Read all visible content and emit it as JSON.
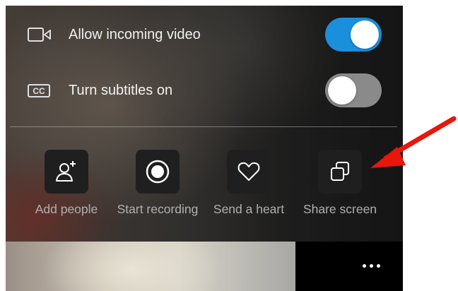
{
  "settings": [
    {
      "label": "Allow incoming video",
      "icon": "video-camera-icon",
      "enabled": true
    },
    {
      "label": "Turn subtitles on",
      "icon": "closed-captions-icon",
      "enabled": false
    }
  ],
  "actions": [
    {
      "label": "Add people",
      "icon": "add-person-icon"
    },
    {
      "label": "Start recording",
      "icon": "record-icon"
    },
    {
      "label": "Send a heart",
      "icon": "heart-icon"
    },
    {
      "label": "Share screen",
      "icon": "share-screen-icon"
    }
  ],
  "cc_glyph": "CC",
  "colors": {
    "toggle_on": "#1a8fdc",
    "toggle_off": "#8a8a8a",
    "annotation_arrow": "#e8160c"
  }
}
